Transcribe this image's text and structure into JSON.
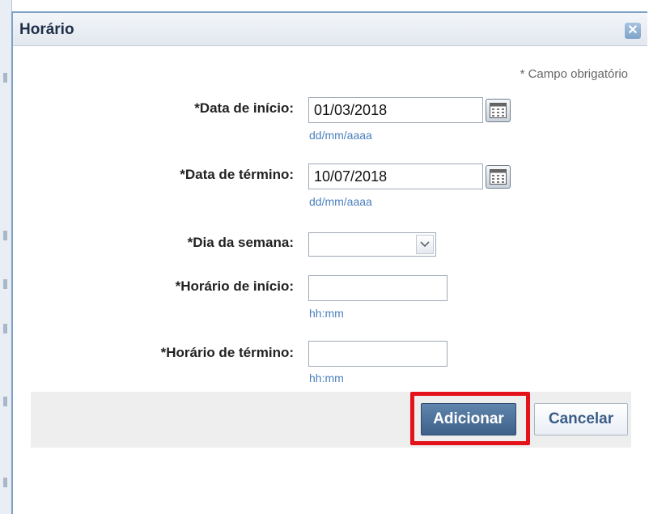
{
  "dialog": {
    "title": "Horário",
    "close_icon": "close-icon",
    "required_note": "* Campo obrigatório"
  },
  "form": {
    "start_date": {
      "label": "*Data de início:",
      "value": "01/03/2018",
      "hint": "dd/mm/aaaa",
      "icon": "calendar-icon"
    },
    "end_date": {
      "label": "*Data de término:",
      "value": "10/07/2018",
      "hint": "dd/mm/aaaa",
      "icon": "calendar-icon"
    },
    "weekday": {
      "label": "*Dia da semana:",
      "value": "",
      "icon": "chevron-down-icon"
    },
    "start_time": {
      "label": "*Horário de início:",
      "value": "",
      "hint": "hh:mm"
    },
    "end_time": {
      "label": "*Horário de término:",
      "value": "",
      "hint": "hh:mm"
    }
  },
  "actions": {
    "add_label": "Adicionar",
    "cancel_label": "Cancelar",
    "highlight_color": "#e3121b"
  }
}
